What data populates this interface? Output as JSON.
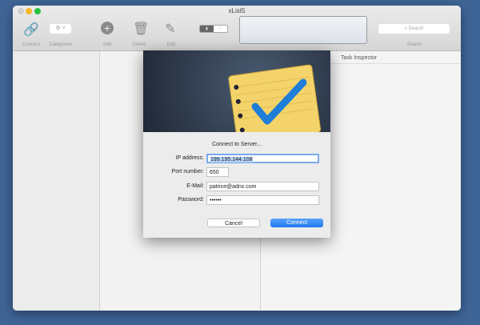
{
  "window": {
    "title": "xList5"
  },
  "toolbar": {
    "connect": "Connect",
    "categories": "Categories",
    "add": "Add",
    "delete": "Delete",
    "edit": "Edit",
    "search_placeholder": "Search",
    "search_label": "Search"
  },
  "inspector": {
    "title": "Task Inspector"
  },
  "dialog": {
    "heading": "Connect to Server...",
    "ip_label": "IP address:",
    "ip_value": "199.195.144.108",
    "port_label": "Port number:",
    "port_value": "650",
    "email_label": "E-Mail:",
    "email_value": "patrice@adnx.com",
    "password_label": "Password:",
    "password_value": "••••••",
    "cancel": "Cancel",
    "connect": "Connect"
  },
  "colors": {
    "accent": "#2a7ef5",
    "desktop": "#3f6597"
  }
}
